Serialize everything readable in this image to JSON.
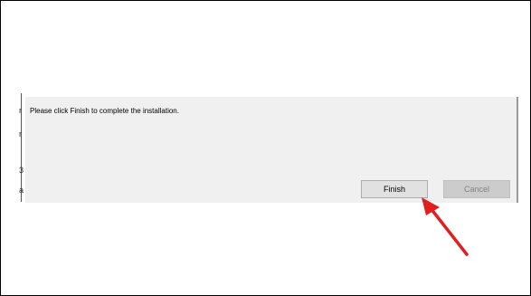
{
  "dialog": {
    "message": "Please click Finish to complete the installation.",
    "finish_label": "Finish",
    "cancel_label": "Cancel"
  },
  "annotation": {
    "arrow_color": "#e02020",
    "arrow_target": "finish-button"
  },
  "colors": {
    "dialog_bg": "#f0f0f0",
    "button_bg": "#e1e1e1",
    "disabled_text": "#838383"
  }
}
